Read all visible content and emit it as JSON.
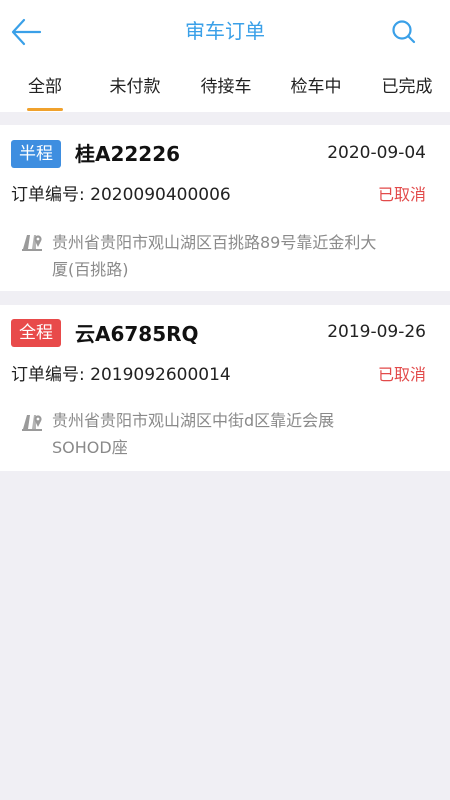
{
  "header": {
    "title": "审车订单",
    "back_icon": "arrow-left-icon",
    "search_icon": "search-icon",
    "accent_color": "#3aa0e8"
  },
  "tabs": [
    {
      "label": "全部",
      "active": true
    },
    {
      "label": "未付款",
      "active": false
    },
    {
      "label": "待接车",
      "active": false
    },
    {
      "label": "检车中",
      "active": false
    },
    {
      "label": "已完成",
      "active": false
    }
  ],
  "orders": [
    {
      "badge": "半程",
      "badge_color": "#3e8ee0",
      "plate": "桂A22226",
      "date": "2020-09-04",
      "order_no_label": "订单编号:",
      "order_no": "2020090400006",
      "status": "已取消",
      "address_line1": "贵州省贵阳市观山湖区百挑路89号靠近金利大",
      "address_line2": "厦(百挑路)"
    },
    {
      "badge": "全程",
      "badge_color": "#e84a4a",
      "plate": "云A6785RQ",
      "date": "2019-09-26",
      "order_no_label": "订单编号:",
      "order_no": "2019092600014",
      "status": "已取消",
      "address_line1": "贵州省贵阳市观山湖区中街d区靠近会展",
      "address_line2": "SOHOD座"
    }
  ]
}
